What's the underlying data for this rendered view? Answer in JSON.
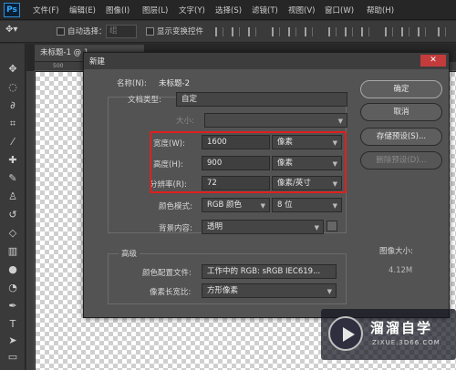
{
  "app": {
    "logo": "Ps"
  },
  "menu": [
    "文件(F)",
    "编辑(E)",
    "图像(I)",
    "图层(L)",
    "文字(Y)",
    "选择(S)",
    "滤镜(T)",
    "视图(V)",
    "窗口(W)",
    "帮助(H)"
  ],
  "options_bar": {
    "auto_select_label": "自动选择：",
    "auto_select_value": "组",
    "show_transform_label": "显示变换控件"
  },
  "document_tab": {
    "title": "未标题-1 @ 1..."
  },
  "ruler": {
    "label": "500"
  },
  "tools": [
    "move-icon",
    "marquee-icon",
    "lasso-icon",
    "crop-icon",
    "eyedropper-icon",
    "healing-icon",
    "brush-icon",
    "stamp-icon",
    "history-brush-icon",
    "eraser-icon",
    "gradient-icon",
    "blur-icon",
    "dodge-icon",
    "pen-icon",
    "type-icon",
    "path-select-icon",
    "shape-icon"
  ],
  "dialog": {
    "title": "新建",
    "name_label": "名称(N):",
    "name_value": "未标题-2",
    "preset_label": "文档类型:",
    "preset_value": "自定",
    "size_label": "大小:",
    "width_label": "宽度(W):",
    "width_value": "1600",
    "width_unit": "像素",
    "height_label": "高度(H):",
    "height_value": "900",
    "height_unit": "像素",
    "resolution_label": "分辨率(R):",
    "resolution_value": "72",
    "resolution_unit": "像素/英寸",
    "color_mode_label": "颜色模式:",
    "color_mode_value": "RGB 颜色",
    "bit_depth_value": "8 位",
    "background_label": "背景内容:",
    "background_value": "透明",
    "advanced_label": "高级",
    "color_profile_label": "颜色配置文件:",
    "color_profile_value": "工作中的 RGB: sRGB IEC619...",
    "pixel_aspect_label": "像素长宽比:",
    "pixel_aspect_value": "方形像素",
    "image_size_label": "图像大小:",
    "image_size_value": "4.12M",
    "ok_button": "确定",
    "cancel_button": "取消",
    "save_preset_button": "存储预设(S)...",
    "delete_preset_button": "删除预设(D)..."
  },
  "watermark": {
    "text": "溜溜自学",
    "url": "ZIXUE.3D66.COM"
  },
  "colors": {
    "highlight": "#e01f1f",
    "dialog_bg": "#535353",
    "ps_blue": "#31a8ff"
  }
}
